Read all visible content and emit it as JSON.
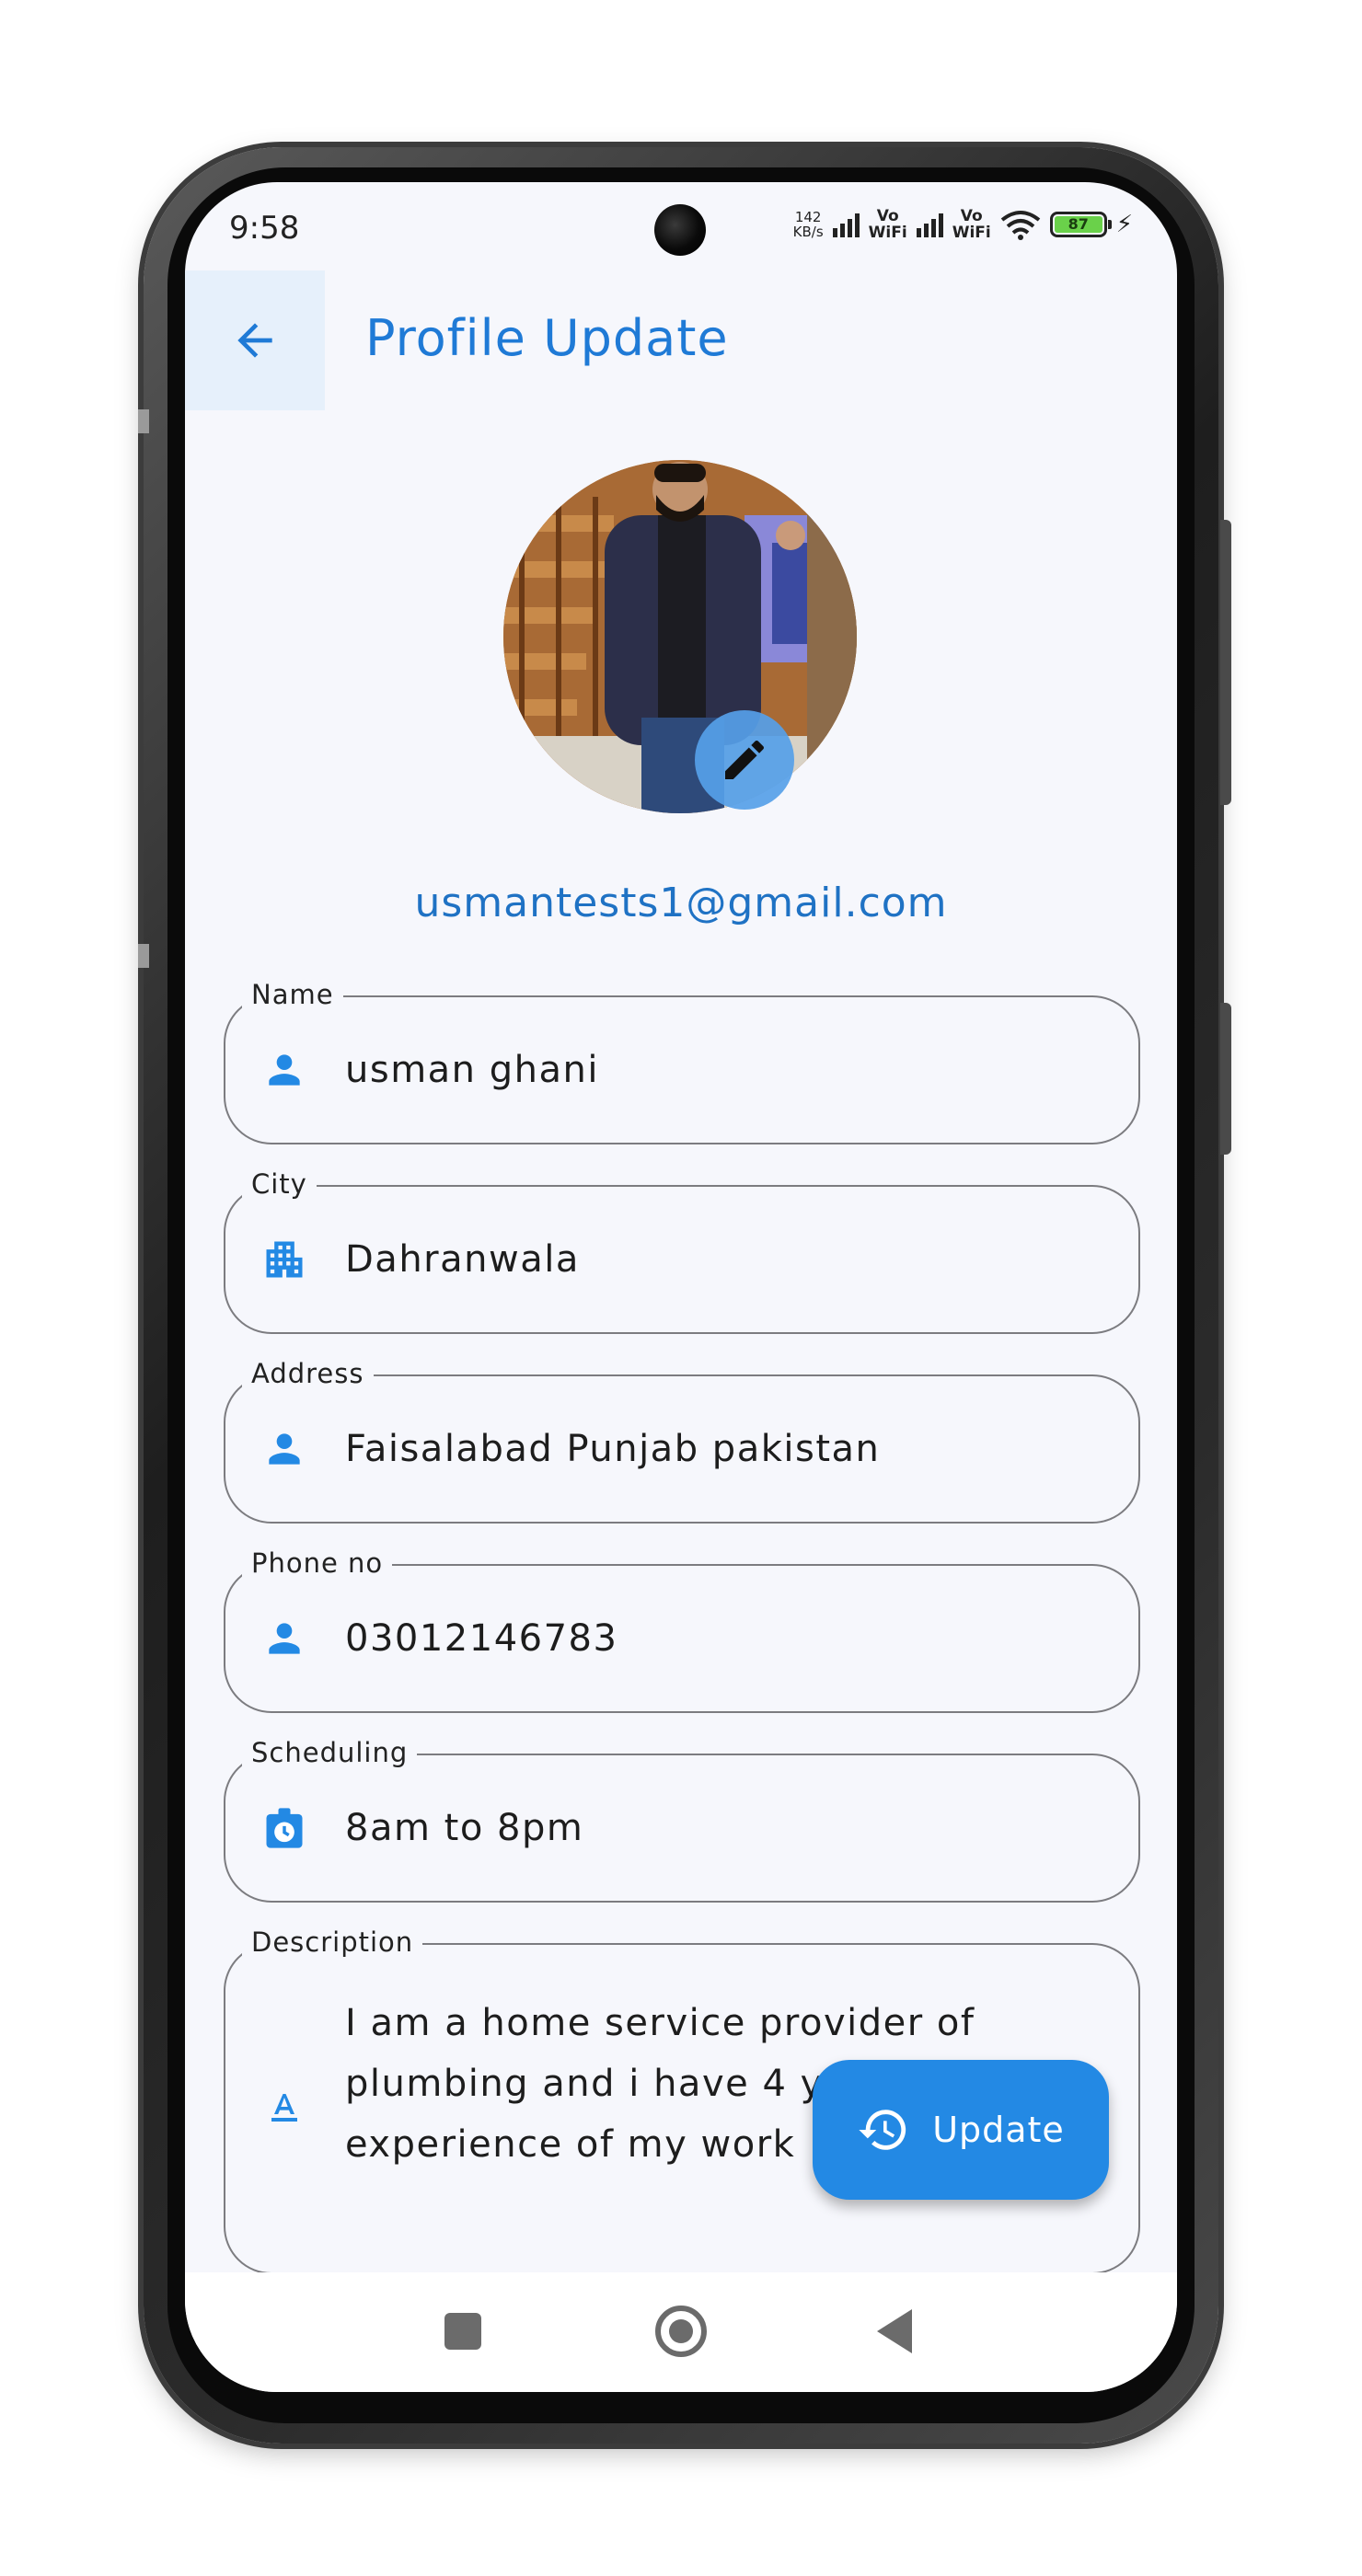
{
  "status_bar": {
    "time": "9:58",
    "net_speed_value": "142",
    "net_speed_unit": "KB/s",
    "vowifi_label_1": "Vo",
    "vowifi_label_2": "WiFi",
    "battery_level": "87"
  },
  "app_bar": {
    "title": "Profile Update",
    "back_icon": "arrow-back-icon"
  },
  "profile": {
    "email": "usmantests1@gmail.com",
    "edit_icon": "pencil-icon"
  },
  "fields": {
    "name": {
      "label": "Name",
      "value": "usman ghani",
      "icon": "person-icon"
    },
    "city": {
      "label": "City",
      "value": "Dahranwala",
      "icon": "apartment-icon"
    },
    "address": {
      "label": "Address",
      "value": "Faisalabad Punjab pakistan",
      "icon": "person-icon"
    },
    "phone": {
      "label": "Phone no",
      "value": "03012146783",
      "icon": "person-icon"
    },
    "scheduling": {
      "label": "Scheduling",
      "value": "8am to 8pm",
      "icon": "clock-bag-icon"
    },
    "description": {
      "label": "Description",
      "value": "I am a home service provider of plumbing and i have 4 years experience of my work",
      "icon": "text-format-icon"
    }
  },
  "fab": {
    "label": "Update",
    "icon": "refresh-clock-icon"
  },
  "colors": {
    "primary": "#1f7ad6",
    "icon": "#2389e4",
    "background": "#f6f7fc",
    "border": "#7c7c80"
  }
}
